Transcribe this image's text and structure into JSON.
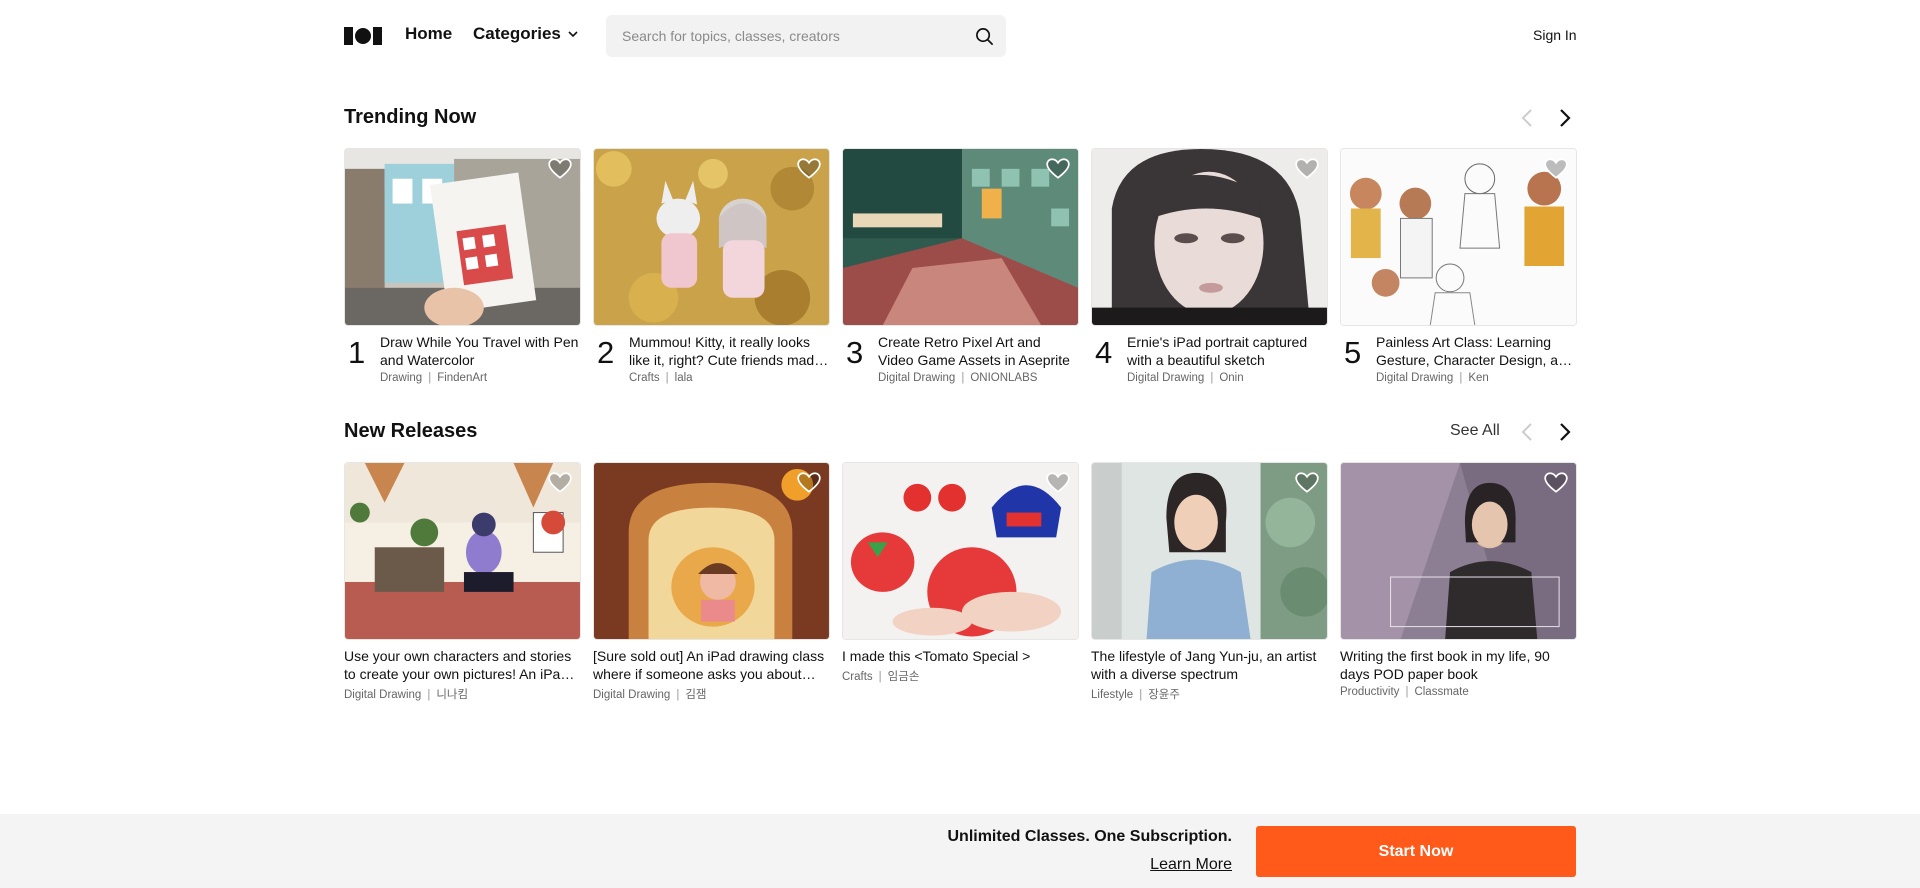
{
  "header": {
    "home_label": "Home",
    "categories_label": "Categories",
    "search_placeholder": "Search for topics, classes, creators",
    "signin_label": "Sign In"
  },
  "trending": {
    "title": "Trending Now",
    "items": [
      {
        "rank": "1",
        "title": "Draw While You Travel with Pen and Watercolor",
        "category": "Drawing",
        "creator": "FindenArt"
      },
      {
        "rank": "2",
        "title": "Mummou! Kitty, it really looks like it, right? Cute friends made with felt",
        "category": "Crafts",
        "creator": "lala"
      },
      {
        "rank": "3",
        "title": "Create Retro Pixel Art and Video Game Assets in Aseprite",
        "category": "Digital Drawing",
        "creator": "ONIONLABS"
      },
      {
        "rank": "4",
        "title": "Ernie's iPad portrait captured with a beautiful sketch",
        "category": "Digital Drawing",
        "creator": "Onin"
      },
      {
        "rank": "5",
        "title": "Painless Art Class: Learning Gesture, Character Design, and Anatomy",
        "category": "Digital Drawing",
        "creator": "Ken"
      }
    ]
  },
  "new_releases": {
    "title": "New Releases",
    "see_all_label": "See All",
    "items": [
      {
        "title": "Use your own characters and stories to create your own pictures! An iPad drawing class",
        "category": "Digital Drawing",
        "creator": "니나킴"
      },
      {
        "title": "[Sure sold out] An iPad drawing class where if someone asks you about your home",
        "category": "Digital Drawing",
        "creator": "김잼"
      },
      {
        "title": "I made this <Tomato Special >",
        "category": "Crafts",
        "creator": "임금손"
      },
      {
        "title": "The lifestyle of Jang Yun-ju, an artist with a diverse spectrum",
        "category": "Lifestyle",
        "creator": "장윤주"
      },
      {
        "title": "Writing the first book in my life, 90 days POD paper book",
        "category": "Productivity",
        "creator": "Classmate"
      }
    ]
  },
  "banner": {
    "title": "Unlimited Classes. One Subscription.",
    "link_label": "Learn More",
    "cta_label": "Start Now"
  },
  "colors": {
    "accent": "#ff5a1a",
    "banner_bg": "#f4f4f4",
    "search_bg": "#f2f2f2"
  }
}
